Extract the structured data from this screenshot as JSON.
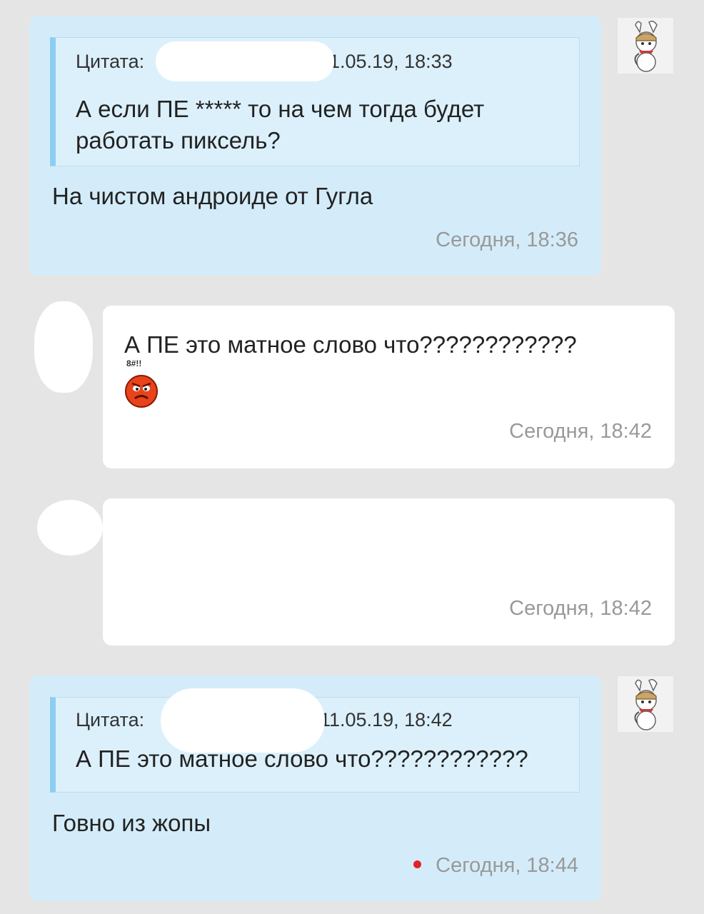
{
  "messages": [
    {
      "quote": {
        "label": "Цитата:",
        "date": "11.05.19, 18:33",
        "text": "А если ПЕ ***** то на чем тогда будет работать пиксель?"
      },
      "text": "На чистом андроиде от Гугла",
      "time": "Сегодня, 18:36"
    },
    {
      "text": "А ПЕ это матное слово что????????????",
      "emoji_caption": "8#!!",
      "time": "Сегодня, 18:42"
    },
    {
      "time": "Сегодня, 18:42"
    },
    {
      "quote": {
        "label": "Цитата:",
        "date": "11.05.19, 18:42",
        "text": "А ПЕ это матное слово что????????????"
      },
      "text": "Говно из жопы",
      "time": "Сегодня, 18:44"
    }
  ],
  "icons": {
    "own_avatar": "mi-bunny-avatar-icon",
    "emoji": "angry-face-icon",
    "unread": "unread-dot-icon"
  },
  "colors": {
    "own_bubble": "#d4ecf9",
    "other_bubble": "#ffffff",
    "quote_bar": "#8ecdf2",
    "unread_dot": "#e2212a"
  }
}
